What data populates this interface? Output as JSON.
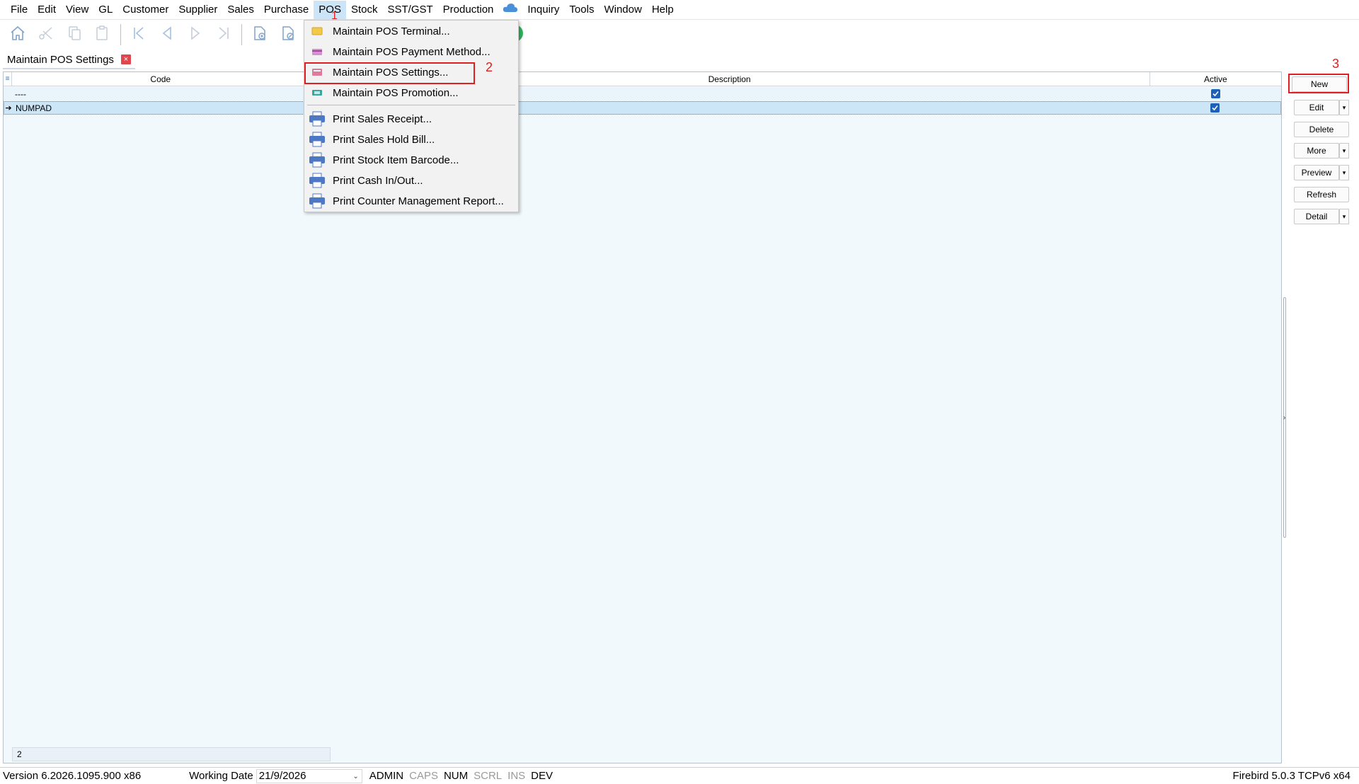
{
  "menubar": {
    "items": [
      "File",
      "Edit",
      "View",
      "GL",
      "Customer",
      "Supplier",
      "Sales",
      "Purchase",
      "POS",
      "Stock",
      "SST/GST",
      "Production",
      "Inquiry",
      "Tools",
      "Window",
      "Help"
    ],
    "active": "POS"
  },
  "colors": {
    "accent": "#1e5fb8",
    "annotation": "#e02020",
    "grid_bg": "#f2f9fc",
    "menu_active": "#cce4f7"
  },
  "tab": {
    "title": "Maintain POS Settings",
    "close_glyph": "×"
  },
  "grid": {
    "columns": [
      "Code",
      "Description",
      "Active"
    ],
    "rows": [
      {
        "code": "----",
        "description": "",
        "active": true
      },
      {
        "code": "NUMPAD",
        "description": "",
        "active": true
      }
    ],
    "row_count": "2"
  },
  "pos_menu": {
    "items": [
      {
        "label": "Maintain POS Terminal...",
        "icon": "terminal-icon"
      },
      {
        "label": "Maintain POS Payment Method...",
        "icon": "payment-card-icon"
      },
      {
        "label": "Maintain POS Settings...",
        "icon": "settings-icon"
      },
      {
        "label": "Maintain POS Promotion...",
        "icon": "promotion-icon"
      }
    ],
    "print_items": [
      {
        "label": "Print Sales Receipt...",
        "icon": "printer-icon"
      },
      {
        "label": "Print Sales Hold Bill...",
        "icon": "printer-icon"
      },
      {
        "label": "Print Stock Item Barcode...",
        "icon": "printer-icon"
      },
      {
        "label": "Print Cash In/Out...",
        "icon": "printer-icon"
      },
      {
        "label": "Print Counter Management Report...",
        "icon": "printer-icon"
      }
    ]
  },
  "side_buttons": {
    "new": "New",
    "edit": "Edit",
    "delete": "Delete",
    "more": "More",
    "preview": "Preview",
    "refresh": "Refresh",
    "detail": "Detail"
  },
  "annotations": {
    "one": "1",
    "two": "2",
    "three": "3"
  },
  "statusbar": {
    "version": "Version 6.2026.1095.900 x86",
    "working_date_label": "Working Date",
    "working_date": "21/9/2026",
    "user": "ADMIN",
    "caps": "CAPS",
    "num": "NUM",
    "scrl": "SCRL",
    "ins": "INS",
    "dev": "DEV",
    "db": "Firebird 5.0.3 TCPv6 x64"
  }
}
